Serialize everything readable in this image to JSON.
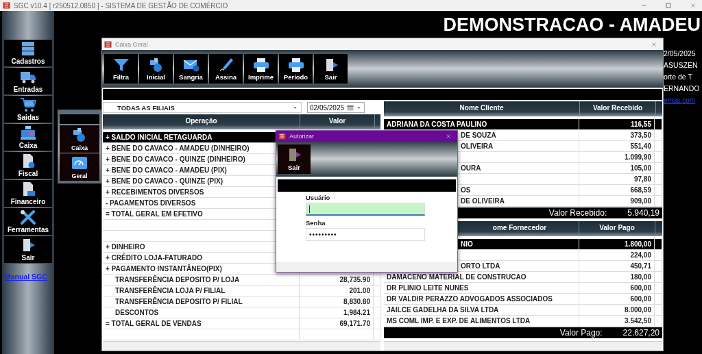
{
  "app_title": "SGC v10.4 [ r250512.0850 ] - SISTEMA DE GESTÃO DE COMÉRCIO",
  "sidebar": {
    "items": [
      {
        "label": "Cadastros"
      },
      {
        "label": "Entradas"
      },
      {
        "label": "Saidas"
      },
      {
        "label": "Caixa"
      },
      {
        "label": "Fiscal"
      },
      {
        "label": "Financeiro"
      },
      {
        "label": "Ferramentas"
      },
      {
        "label": "Sair"
      }
    ],
    "manual_link": "Manual SGC"
  },
  "submenu": {
    "items": [
      {
        "label": "Caixa"
      },
      {
        "label": "Geral"
      }
    ]
  },
  "company_heading": "DEMONSTRACAO - AMADEU",
  "info_lines": [
    "2/05/2025",
    "ASUSZEN",
    "orte de T",
    "ERNANDO"
  ],
  "info_link": "emas.com",
  "caixa_window": {
    "title": "Caixa Geral",
    "toolbar": [
      {
        "label": "Filtra"
      },
      {
        "label": "Inicial"
      },
      {
        "label": "Sangria"
      },
      {
        "label": "Assina"
      },
      {
        "label": "Imprime"
      },
      {
        "label": "Período"
      },
      {
        "label": "Sair"
      }
    ],
    "branch_filter": "TODAS AS FILIAIS",
    "date": "02/05/2025",
    "operations": {
      "columns": [
        "Operação",
        "Valor"
      ],
      "rows": [
        {
          "label": "+ SALDO INICIAL RETAGUARDA",
          "selected": true,
          "kind": "main"
        },
        {
          "label": "+ BENE DO CAVACO - AMADEU (DINHEIRO)",
          "selected": false,
          "kind": "main"
        },
        {
          "label": "+ BENE DO CAVACO - QUINZE (DINHEIRO)",
          "selected": false,
          "kind": "main"
        },
        {
          "label": "+ BENE DO CAVACO - AMADEU (PIX)",
          "selected": false,
          "kind": "main"
        },
        {
          "label": "+ BENE DO CAVACO - QUINZE (PIX)",
          "selected": false,
          "kind": "main"
        },
        {
          "label": "+ RECEBIMENTOS DIVERSOS",
          "selected": false,
          "kind": "main"
        },
        {
          "label": "- PAGAMENTOS DIVERSOS",
          "selected": false,
          "kind": "main"
        },
        {
          "label": "= TOTAL GERAL EM EFETIVO",
          "selected": false,
          "kind": "main"
        },
        {
          "selected": false,
          "kind": "main"
        },
        {
          "selected": false,
          "kind": "main"
        },
        {
          "label": "+ DINHEIRO",
          "selected": false,
          "kind": "main"
        },
        {
          "label": "+ CRÉDITO LOJA-FATURADO",
          "selected": false,
          "kind": "main"
        },
        {
          "label": "+ PAGAMENTO INSTANTÂNEO(PIX)",
          "selected": false,
          "kind": "main"
        },
        {
          "label": "TRANSFERÊNCIA DEPOSITO P/ LOJA",
          "value": "28,735.90",
          "selected": false,
          "kind": "detail"
        },
        {
          "label": "TRANSFERÊNCIA LOJA P/ FILIAL",
          "value": "201.00",
          "selected": false,
          "kind": "detail"
        },
        {
          "label": "TRANSFERÊNCIA DEPOSITO P/ FILIAL",
          "value": "8,830.80",
          "selected": false,
          "kind": "detail"
        },
        {
          "label": "DESCONTOS",
          "value": "1,984.21",
          "selected": false,
          "kind": "detail"
        },
        {
          "label": "= TOTAL GERAL DE VENDAS",
          "value": "69,171.70",
          "selected": false,
          "kind": "main"
        },
        {
          "selected": false,
          "kind": "main"
        }
      ]
    },
    "receipts": {
      "columns": [
        "Nome Cliente",
        "Valor Recebido"
      ],
      "rows": [
        {
          "name": "ADRIANA DA COSTA PAULINO",
          "value": "116,55",
          "selected": true
        },
        {
          "name": "DE SOUZA",
          "value": "373,50",
          "selected": false
        },
        {
          "name": "OLIVEIRA",
          "value": "551,40",
          "selected": false
        },
        {
          "value": "1.099,90",
          "selected": false
        },
        {
          "name": "OURA",
          "value": "105,00",
          "selected": false
        },
        {
          "value": "97,80",
          "selected": false
        },
        {
          "name": "OS",
          "value": "668,59",
          "selected": false
        },
        {
          "name": "DE OLIVEIRA",
          "value": "909,00",
          "selected": false
        }
      ],
      "total_label": "Valor Recebido:",
      "total": "5.940,19"
    },
    "payments": {
      "columns": [
        "ome Fornecedor",
        "Valor Pago"
      ],
      "rows": [
        {
          "name": "NIO",
          "value": "1.800,00",
          "selected": true
        },
        {
          "value": "224,00",
          "selected": false
        },
        {
          "name": "ORTO LTDA",
          "value": "450,71",
          "selected": false
        },
        {
          "name": "DAMACENO MATERIAL DE CONSTRUCAO",
          "value": "180,00",
          "selected": false
        },
        {
          "name": "DR PLINIO LEITE NUNES",
          "value": "600,00",
          "selected": false
        },
        {
          "name": "DR VALDIR PERAZZO ADVOGADOS ASSOCIADOS",
          "value": "600,00",
          "selected": false
        },
        {
          "name": "JAILCE GADELHA DA SILVA LTDA",
          "value": "8.000,00",
          "selected": false
        },
        {
          "name": "MS COML IMP. E EXP. DE ALIMENTOS LTDA",
          "value": "3.542,50",
          "selected": false
        }
      ],
      "total_label": "Valor Pago:",
      "total": "22.627,20"
    }
  },
  "auth_dialog": {
    "title": "Autorizar",
    "toolbar": [
      {
        "label": "Sair"
      }
    ],
    "user_label": "Usuário",
    "user_focused": true,
    "password_label": "Senha",
    "password": "•••••••••"
  }
}
